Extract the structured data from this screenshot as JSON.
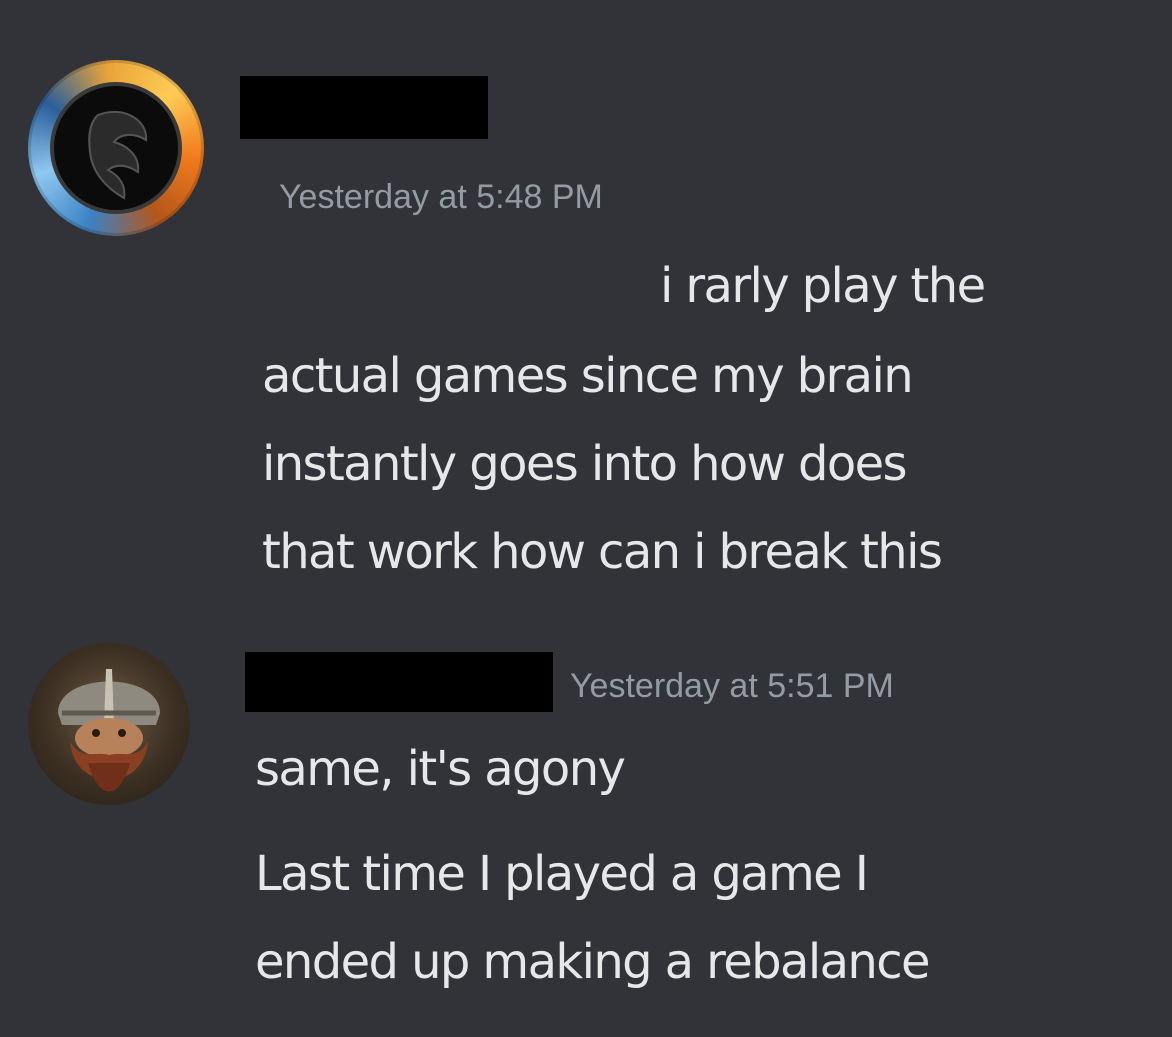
{
  "messages": [
    {
      "avatar_icon": "mortal-kombat-dragon-logo-avatar",
      "username_redacted": true,
      "timestamp": "Yesterday at 5:48 PM",
      "lines": [
        "i rarly play the",
        "actual games since my brain",
        "instantly goes into how does",
        "that work how can i break this"
      ]
    },
    {
      "avatar_icon": "dwarf-warrior-avatar",
      "username_redacted": true,
      "timestamp": "Yesterday at 5:51 PM",
      "lines": [
        "same, it's agony"
      ]
    },
    {
      "lines": [
        "Last time I played a game I",
        "ended up making a rebalance"
      ]
    }
  ],
  "colors": {
    "background": "#313338",
    "timestamp": "#949ba4",
    "message_text": "#e6e7e9",
    "redaction": "#000000"
  }
}
